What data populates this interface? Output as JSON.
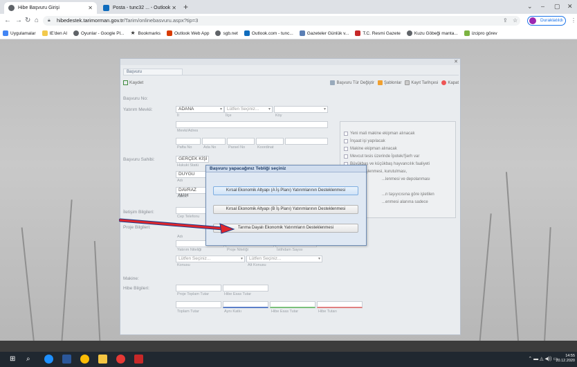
{
  "browser": {
    "tabs": [
      {
        "title": "Hibe Başvuru Girişi",
        "active": true
      },
      {
        "title": "Posta - tunc32 ... - Outlook",
        "active": false
      }
    ],
    "url_host": "hibedestek.tarimorman.gov.tr",
    "url_path": "/Tarim/onlinebasvuru.aspx?tip=3",
    "profile_label": "Duraklatıldı",
    "bookmarks": [
      "Uygulamalar",
      "IE'den Al",
      "Oyunlar - Google Pl...",
      "Bookmarks",
      "Outlook Web App",
      "sgb.net",
      "Outlook.com - tunc...",
      "Gazeteler Günlük v...",
      "T.C. Resmi Gazete",
      "Kuzu Göbeği manta...",
      "izcipro görev"
    ]
  },
  "form": {
    "tab_label": "Başvuru",
    "save_label": "Kaydet",
    "toolbar": [
      "Başvuru Tür Değiştir",
      "Şablonlar",
      "Kayıt Tarihçesi",
      "Kapat"
    ],
    "labels": {
      "basvuru_no": "Başvuru No:",
      "yatirim_mevkii": "Yatırım Mevkii:",
      "basvuru_sahibi": "Başvuru Sahibi:",
      "iletisim": "İletişim Bilgileri:",
      "proje": "Proje Bilgileri:",
      "makine": "Makine:",
      "hibe": "Hibe Bilgileri:"
    },
    "il_value": "ADANA",
    "ilce_placeholder": "Lütfen Seçiniz...",
    "sub": {
      "il": "İl",
      "ilce": "İlçe",
      "koy": "Köy",
      "mevki": "Mevki/Adres",
      "pafta": "Pafta No",
      "ada": "Ada No",
      "parsel": "Parsel No",
      "koordinat": "Koordinat",
      "hukuki": "Hukuki Statü",
      "adi": "Adı",
      "adres": "Adres",
      "cep": "Cep Telefonu",
      "adi2": "Adı",
      "yatirim_niteligi": "Yatırım Niteliği",
      "proje_niteligi": "Proje Niteliği",
      "istihdam": "İstihdam Sayısı",
      "konusu": "Konusu",
      "alt_konusu": "Alt Konusu",
      "proje_toplam": "Proje Toplam Tutar",
      "hibe_esas": "Hibe Esas Tutar",
      "toplam": "Toplam Tutar",
      "ayni_katki": "Aynı Katkı",
      "hibe_esas2": "Hibe Esas Tutar",
      "hibe_tutari": "Hibe Tutarı"
    },
    "sahibi_value": "GERÇEK KİŞİ",
    "name_value": "DUYGU",
    "address_value": "DAVRAZ MAH",
    "select_placeholder_1": "Lütfen Seçiniz...",
    "select_placeholder_2": "Lütfen Seçiniz...",
    "checkboxes": [
      "Yeni mali makine ekipman alınacak",
      "İnşaat işi yapılacak",
      "Makine ekipman alınacak",
      "Mevcut tesis üzerinde İpotek/Şerh var",
      "Büyükbaş ve küçükbaş hayvancılık faaliyeti",
      "Ürünün işlenmesi, kurutulması,",
      "...lenmesi ve depolanması",
      "...n taşıyıcısına göre işletilen",
      "...enmesi alanına sadece"
    ]
  },
  "dialog": {
    "title": "Başvuru yapacağınız Tebliği seçiniz",
    "options": [
      "Kırsal Ekonomik Altyapı (A İş Planı) Yatırımlarının Desteklenmesi",
      "Kırsal Ekonomik Altyapı (B İş Planı) Yatırımlarının Desteklenmesi",
      "Tarıma Dayalı Ekonomik Yatırımların Desteklenmesi"
    ]
  },
  "taskbar": {
    "time": "14:55",
    "date": "20.12.2020"
  },
  "colors": {
    "accent": "#1a73e8",
    "arrow": "#e0262b",
    "dialog_border": "#6f8db5"
  }
}
